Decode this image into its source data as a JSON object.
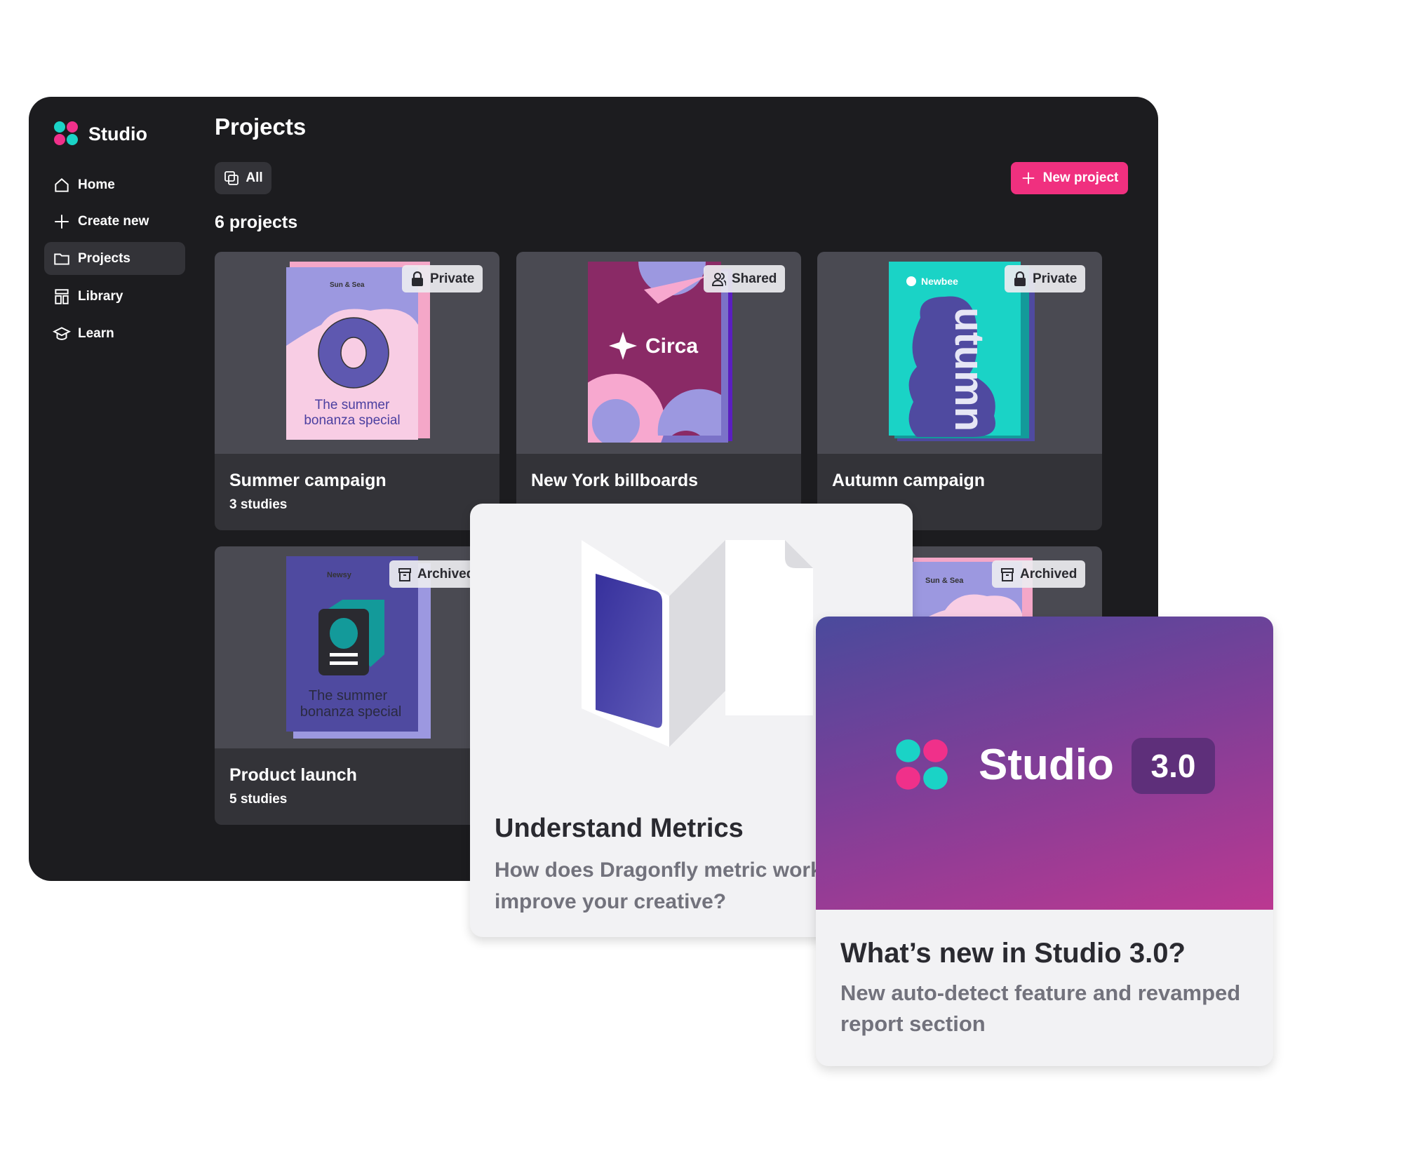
{
  "app": {
    "name": "Studio"
  },
  "sidebar": {
    "items": [
      {
        "label": "Home",
        "icon": "home-icon"
      },
      {
        "label": "Create new",
        "icon": "plus-icon"
      },
      {
        "label": "Projects",
        "icon": "folder-icon",
        "active": true
      },
      {
        "label": "Library",
        "icon": "library-icon"
      },
      {
        "label": "Learn",
        "icon": "graduation-cap-icon"
      }
    ]
  },
  "main": {
    "title": "Projects",
    "filter_label": "All",
    "new_project_label": "New project",
    "count_label": "6 projects",
    "projects": [
      {
        "title": "Summer campaign",
        "subtitle": "3 studies",
        "badge": "Private",
        "cover_brand": "Sun & Sea",
        "cover_text_1": "The summer",
        "cover_text_2": "bonanza special"
      },
      {
        "title": "New York billboards",
        "badge": "Shared",
        "cover_brand": "Circa"
      },
      {
        "title": "Autumn campaign",
        "badge": "Private",
        "cover_brand": "Newbee",
        "cover_text": "utumn"
      },
      {
        "title": "Product launch",
        "subtitle": "5 studies",
        "badge": "Archived",
        "cover_brand": "Newsy",
        "cover_text_1": "The summer",
        "cover_text_2": "bonanza special"
      },
      {
        "badge": "Archived",
        "cover_brand": "Sun & Sea"
      }
    ]
  },
  "learn_card": {
    "title": "Understand Metrics",
    "description": "How does Dragonfly metric work how you improve your creative?"
  },
  "news_card": {
    "brand": "Studio",
    "version": "3.0",
    "title": "What’s new in Studio 3.0?",
    "description": "New auto-detect feature and revamped report section"
  },
  "colors": {
    "accent": "#f0307f",
    "teal": "#1ad3c6",
    "pink": "#f0308a",
    "panel": "#1c1c1f"
  }
}
